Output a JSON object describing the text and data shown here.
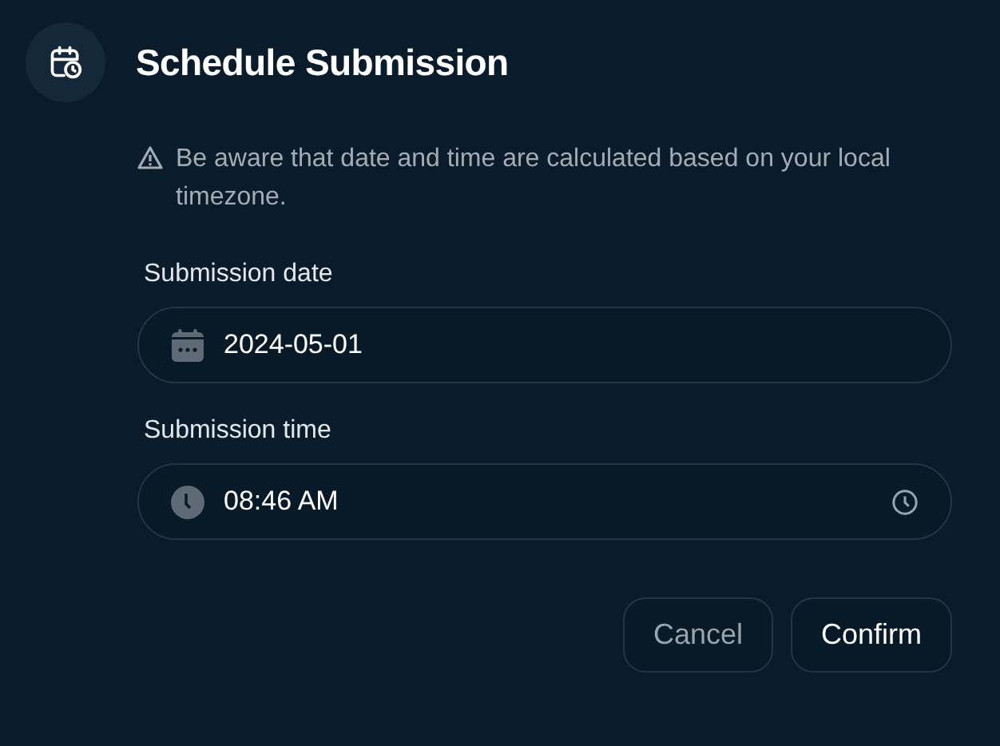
{
  "dialog": {
    "title": "Schedule Submission",
    "warning": "Be aware that date and time are calculated based on your local timezone.",
    "fields": [
      {
        "kind": "date",
        "label": "Submission date",
        "value": "2024-05-01"
      },
      {
        "kind": "time",
        "label": "Submission time",
        "value": "08:46 AM"
      }
    ],
    "buttons": [
      {
        "kind": "secondary",
        "label": "Cancel"
      },
      {
        "kind": "primary",
        "label": "Confirm"
      }
    ]
  }
}
